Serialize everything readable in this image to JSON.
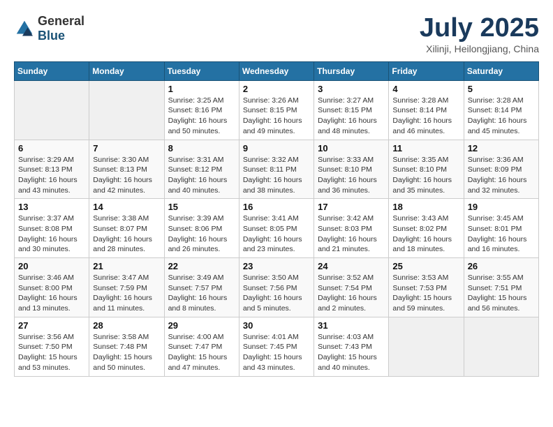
{
  "logo": {
    "general": "General",
    "blue": "Blue"
  },
  "title": "July 2025",
  "subtitle": "Xilinji, Heilongjiang, China",
  "days_header": [
    "Sunday",
    "Monday",
    "Tuesday",
    "Wednesday",
    "Thursday",
    "Friday",
    "Saturday"
  ],
  "weeks": [
    [
      {
        "day": "",
        "info": ""
      },
      {
        "day": "",
        "info": ""
      },
      {
        "day": "1",
        "info": "Sunrise: 3:25 AM\nSunset: 8:16 PM\nDaylight: 16 hours\nand 50 minutes."
      },
      {
        "day": "2",
        "info": "Sunrise: 3:26 AM\nSunset: 8:15 PM\nDaylight: 16 hours\nand 49 minutes."
      },
      {
        "day": "3",
        "info": "Sunrise: 3:27 AM\nSunset: 8:15 PM\nDaylight: 16 hours\nand 48 minutes."
      },
      {
        "day": "4",
        "info": "Sunrise: 3:28 AM\nSunset: 8:14 PM\nDaylight: 16 hours\nand 46 minutes."
      },
      {
        "day": "5",
        "info": "Sunrise: 3:28 AM\nSunset: 8:14 PM\nDaylight: 16 hours\nand 45 minutes."
      }
    ],
    [
      {
        "day": "6",
        "info": "Sunrise: 3:29 AM\nSunset: 8:13 PM\nDaylight: 16 hours\nand 43 minutes."
      },
      {
        "day": "7",
        "info": "Sunrise: 3:30 AM\nSunset: 8:13 PM\nDaylight: 16 hours\nand 42 minutes."
      },
      {
        "day": "8",
        "info": "Sunrise: 3:31 AM\nSunset: 8:12 PM\nDaylight: 16 hours\nand 40 minutes."
      },
      {
        "day": "9",
        "info": "Sunrise: 3:32 AM\nSunset: 8:11 PM\nDaylight: 16 hours\nand 38 minutes."
      },
      {
        "day": "10",
        "info": "Sunrise: 3:33 AM\nSunset: 8:10 PM\nDaylight: 16 hours\nand 36 minutes."
      },
      {
        "day": "11",
        "info": "Sunrise: 3:35 AM\nSunset: 8:10 PM\nDaylight: 16 hours\nand 35 minutes."
      },
      {
        "day": "12",
        "info": "Sunrise: 3:36 AM\nSunset: 8:09 PM\nDaylight: 16 hours\nand 32 minutes."
      }
    ],
    [
      {
        "day": "13",
        "info": "Sunrise: 3:37 AM\nSunset: 8:08 PM\nDaylight: 16 hours\nand 30 minutes."
      },
      {
        "day": "14",
        "info": "Sunrise: 3:38 AM\nSunset: 8:07 PM\nDaylight: 16 hours\nand 28 minutes."
      },
      {
        "day": "15",
        "info": "Sunrise: 3:39 AM\nSunset: 8:06 PM\nDaylight: 16 hours\nand 26 minutes."
      },
      {
        "day": "16",
        "info": "Sunrise: 3:41 AM\nSunset: 8:05 PM\nDaylight: 16 hours\nand 23 minutes."
      },
      {
        "day": "17",
        "info": "Sunrise: 3:42 AM\nSunset: 8:03 PM\nDaylight: 16 hours\nand 21 minutes."
      },
      {
        "day": "18",
        "info": "Sunrise: 3:43 AM\nSunset: 8:02 PM\nDaylight: 16 hours\nand 18 minutes."
      },
      {
        "day": "19",
        "info": "Sunrise: 3:45 AM\nSunset: 8:01 PM\nDaylight: 16 hours\nand 16 minutes."
      }
    ],
    [
      {
        "day": "20",
        "info": "Sunrise: 3:46 AM\nSunset: 8:00 PM\nDaylight: 16 hours\nand 13 minutes."
      },
      {
        "day": "21",
        "info": "Sunrise: 3:47 AM\nSunset: 7:59 PM\nDaylight: 16 hours\nand 11 minutes."
      },
      {
        "day": "22",
        "info": "Sunrise: 3:49 AM\nSunset: 7:57 PM\nDaylight: 16 hours\nand 8 minutes."
      },
      {
        "day": "23",
        "info": "Sunrise: 3:50 AM\nSunset: 7:56 PM\nDaylight: 16 hours\nand 5 minutes."
      },
      {
        "day": "24",
        "info": "Sunrise: 3:52 AM\nSunset: 7:54 PM\nDaylight: 16 hours\nand 2 minutes."
      },
      {
        "day": "25",
        "info": "Sunrise: 3:53 AM\nSunset: 7:53 PM\nDaylight: 15 hours\nand 59 minutes."
      },
      {
        "day": "26",
        "info": "Sunrise: 3:55 AM\nSunset: 7:51 PM\nDaylight: 15 hours\nand 56 minutes."
      }
    ],
    [
      {
        "day": "27",
        "info": "Sunrise: 3:56 AM\nSunset: 7:50 PM\nDaylight: 15 hours\nand 53 minutes."
      },
      {
        "day": "28",
        "info": "Sunrise: 3:58 AM\nSunset: 7:48 PM\nDaylight: 15 hours\nand 50 minutes."
      },
      {
        "day": "29",
        "info": "Sunrise: 4:00 AM\nSunset: 7:47 PM\nDaylight: 15 hours\nand 47 minutes."
      },
      {
        "day": "30",
        "info": "Sunrise: 4:01 AM\nSunset: 7:45 PM\nDaylight: 15 hours\nand 43 minutes."
      },
      {
        "day": "31",
        "info": "Sunrise: 4:03 AM\nSunset: 7:43 PM\nDaylight: 15 hours\nand 40 minutes."
      },
      {
        "day": "",
        "info": ""
      },
      {
        "day": "",
        "info": ""
      }
    ]
  ]
}
